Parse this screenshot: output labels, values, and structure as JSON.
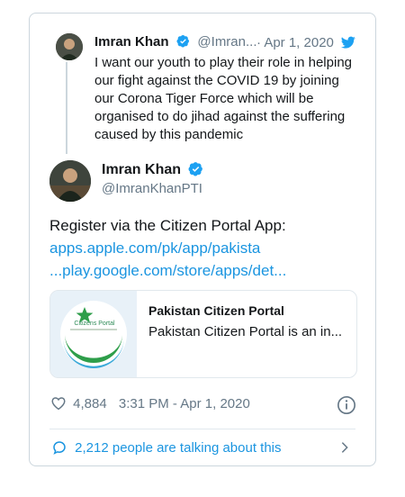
{
  "quoted": {
    "name": "Imran Khan",
    "handle": "@Imran...",
    "date": "· Apr 1, 2020",
    "text": "I want our youth to play their role in helping our fight against the COVID 19 by joining our Corona Tiger Force which will be organised to do jihad against the suffering caused by this pandemic"
  },
  "author": {
    "name": "Imran Khan",
    "handle": "@ImranKhanPTI"
  },
  "tweet": {
    "text": "Register via the Citizen Portal App:",
    "link1": "apps.apple.com/pk/app/pakista",
    "link2": "...play.google.com/store/apps/det..."
  },
  "card": {
    "title": "Pakistan Citizen Portal",
    "description": "Pakistan Citizen Portal is an in...",
    "logo_text": "Citizens Portal"
  },
  "meta": {
    "likes": "4,884",
    "time": "3:31 PM - Apr 1, 2020"
  },
  "footer": {
    "talking": "2,212 people are talking about this"
  },
  "colors": {
    "accent": "#1b95e0",
    "muted": "#657786",
    "border": "#ccd6dd"
  }
}
